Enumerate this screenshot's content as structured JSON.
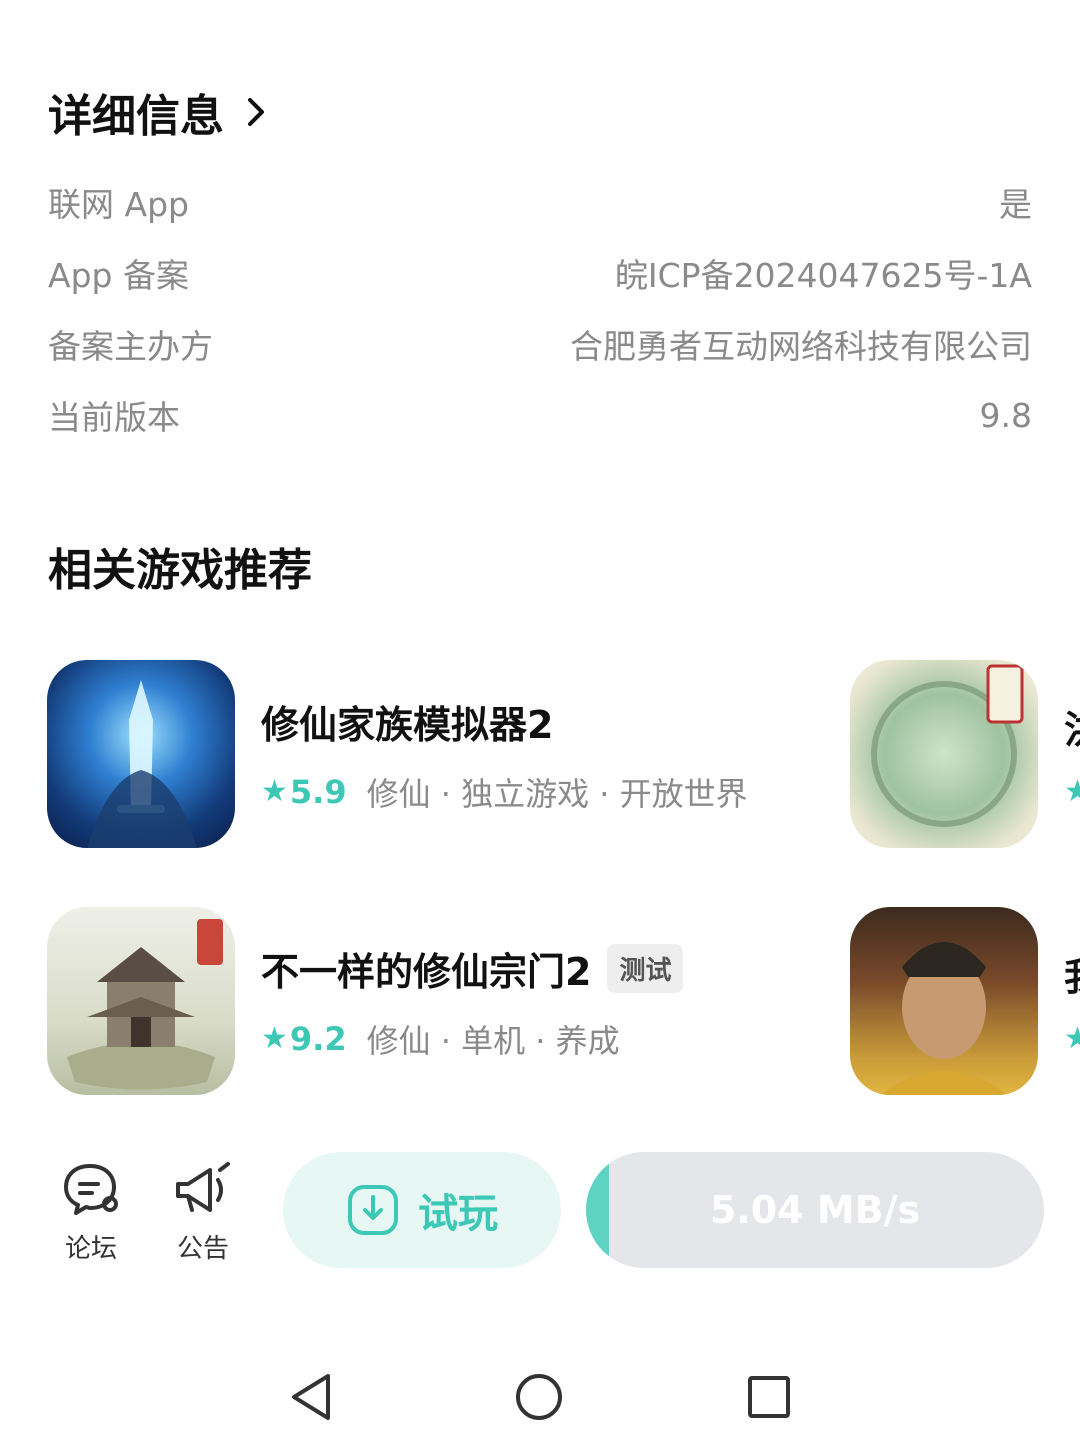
{
  "detail": {
    "title": "详细信息",
    "rows": [
      {
        "label": "联网 App",
        "value": "是"
      },
      {
        "label": "App 备案",
        "value": "皖ICP备2024047625号-1A"
      },
      {
        "label": "备案主办方",
        "value": "合肥勇者互动网络科技有限公司"
      },
      {
        "label": "当前版本",
        "value": "9.8"
      }
    ]
  },
  "recommend": {
    "title": "相关游戏推荐",
    "games": [
      {
        "name": "修仙家族模拟器2",
        "rating": "5.9",
        "tags": "修仙 · 独立游戏 · 开放世界",
        "badge": ""
      },
      {
        "name": "不一样的修仙宗门2",
        "rating": "9.2",
        "tags": "修仙 · 单机 · 养成",
        "badge": "测试"
      }
    ],
    "partial_names": [
      "洪",
      "我"
    ]
  },
  "bottom_bar": {
    "forum_label": "论坛",
    "notice_label": "公告",
    "trial_label": "试玩",
    "download_speed": "5.04 MB/s",
    "download_progress": 0.05
  },
  "colors": {
    "accent": "#3cc8b4",
    "accent_light": "#e6f7f4",
    "progress_track": "#e4e6e9"
  },
  "icons": [
    "chevron-right-icon",
    "star-icon",
    "forum-icon",
    "megaphone-icon",
    "download-icon",
    "nav-back-icon",
    "nav-home-icon",
    "nav-recents-icon"
  ]
}
